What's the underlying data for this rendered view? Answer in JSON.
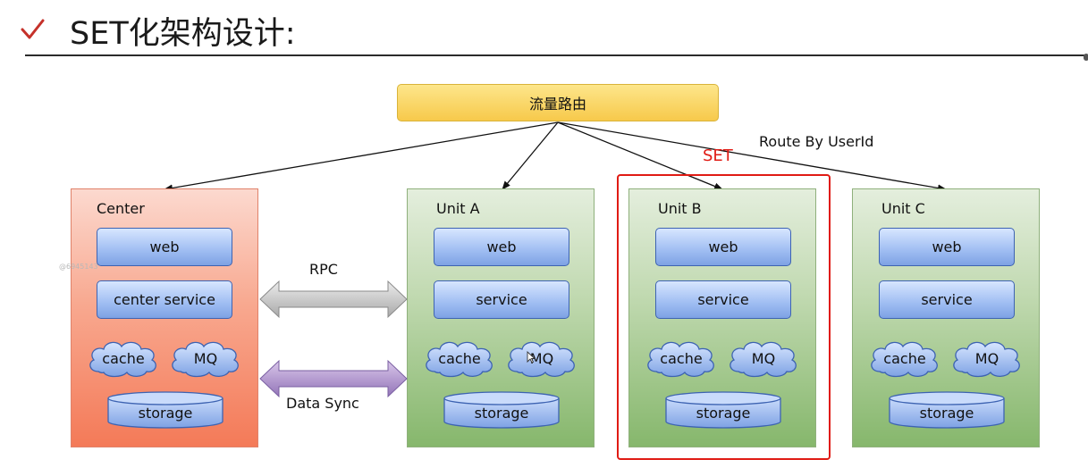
{
  "header": {
    "title": "SET化架构设计:"
  },
  "router": {
    "label": "流量路由"
  },
  "route_label": "Route By UserId",
  "set_label": "SET",
  "watermark": "@6945143",
  "connectors": {
    "rpc": "RPC",
    "data_sync": "Data Sync"
  },
  "colors": {
    "set_border": "#e01b14",
    "check": "#c5312a",
    "router_fill": "#f7c94b",
    "center_fill": "#f47a58",
    "unit_fill": "#86b76c",
    "component_fill": "#9fbdf2"
  },
  "units": [
    {
      "title": "Center",
      "web": "web",
      "service": "center service",
      "cache": "cache",
      "mq": "MQ",
      "storage": "storage"
    },
    {
      "title": "Unit A",
      "web": "web",
      "service": "service",
      "cache": "cache",
      "mq": "MQ",
      "storage": "storage"
    },
    {
      "title": "Unit B",
      "web": "web",
      "service": "service",
      "cache": "cache",
      "mq": "MQ",
      "storage": "storage"
    },
    {
      "title": "Unit C",
      "web": "web",
      "service": "service",
      "cache": "cache",
      "mq": "MQ",
      "storage": "storage"
    }
  ]
}
